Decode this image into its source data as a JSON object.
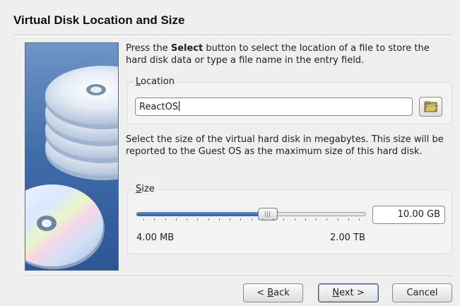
{
  "dialog": {
    "title": "Virtual Disk Location and Size"
  },
  "intro": {
    "pre": "Press the ",
    "bold": "Select",
    "post": " button to select the location of a file to store the hard disk data or type a file name in the entry field."
  },
  "location": {
    "group_title_mnemonic": "L",
    "group_title_rest": "ocation",
    "value": "ReactOS",
    "browse_icon": "folder-open-icon"
  },
  "size": {
    "description": "Select the size of the virtual hard disk in megabytes. This size will be reported to the Guest OS as the maximum size of this hard disk.",
    "group_title_mnemonic": "S",
    "group_title_rest": "ize",
    "value": "10.00 GB",
    "min_label": "4.00 MB",
    "max_label": "2.00 TB",
    "slider_fraction": 0.58
  },
  "buttons": {
    "back_pre": "< ",
    "back_mnemonic": "B",
    "back_rest": "ack",
    "next_mnemonic": "N",
    "next_rest": "ext >",
    "cancel": "Cancel"
  },
  "colors": {
    "accent": "#2e5f9a",
    "side_image_bg": "#3f6ca8"
  }
}
